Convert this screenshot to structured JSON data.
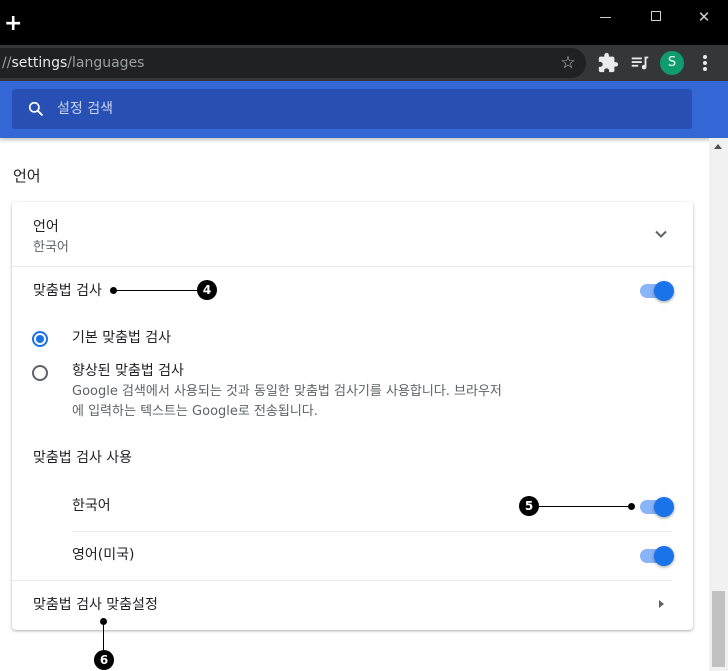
{
  "browser": {
    "new_tab_glyph": "+",
    "window_controls": [
      "minimize",
      "maximize",
      "close"
    ],
    "close_glyph": "✕",
    "url_prefix": "//",
    "url_strong": "settings",
    "url_rest": "/languages",
    "bookmark_glyph": "☆",
    "avatar_letter": "S",
    "avatar_color": "#0f9d6f",
    "icons": [
      "extensions-icon",
      "media-controls-icon",
      "menu-icon"
    ]
  },
  "header": {
    "search_placeholder": "설정 검색",
    "background": "#3367d6"
  },
  "section": {
    "title": "언어"
  },
  "card": {
    "language_row": {
      "label": "언어",
      "value": "한국어",
      "expanded": false
    },
    "spellcheck": {
      "label": "맞춤법 검사",
      "enabled": true
    },
    "radio_options": [
      {
        "label": "기본 맞춤법 검사",
        "checked": true,
        "description": ""
      },
      {
        "label": "향상된 맞춤법 검사",
        "checked": false,
        "description_line1": "Google 검색에서 사용되는 것과 동일한 맞춤법 검사기를 사용합니다. 브라우저",
        "description_line2": "에 입력하는 텍스트는 Google로 전송됩니다."
      }
    ],
    "use_spellcheck_label": "맞춤법 검사 사용",
    "languages": [
      {
        "label": "한국어",
        "enabled": true
      },
      {
        "label": "영어(미국)",
        "enabled": true
      }
    ],
    "customize_label": "맞춤법 검사 맞춤설정"
  },
  "callouts": [
    "4",
    "5",
    "6"
  ],
  "colors": {
    "accent": "#1a73e8",
    "toggle_track": "#8ab4f8"
  }
}
